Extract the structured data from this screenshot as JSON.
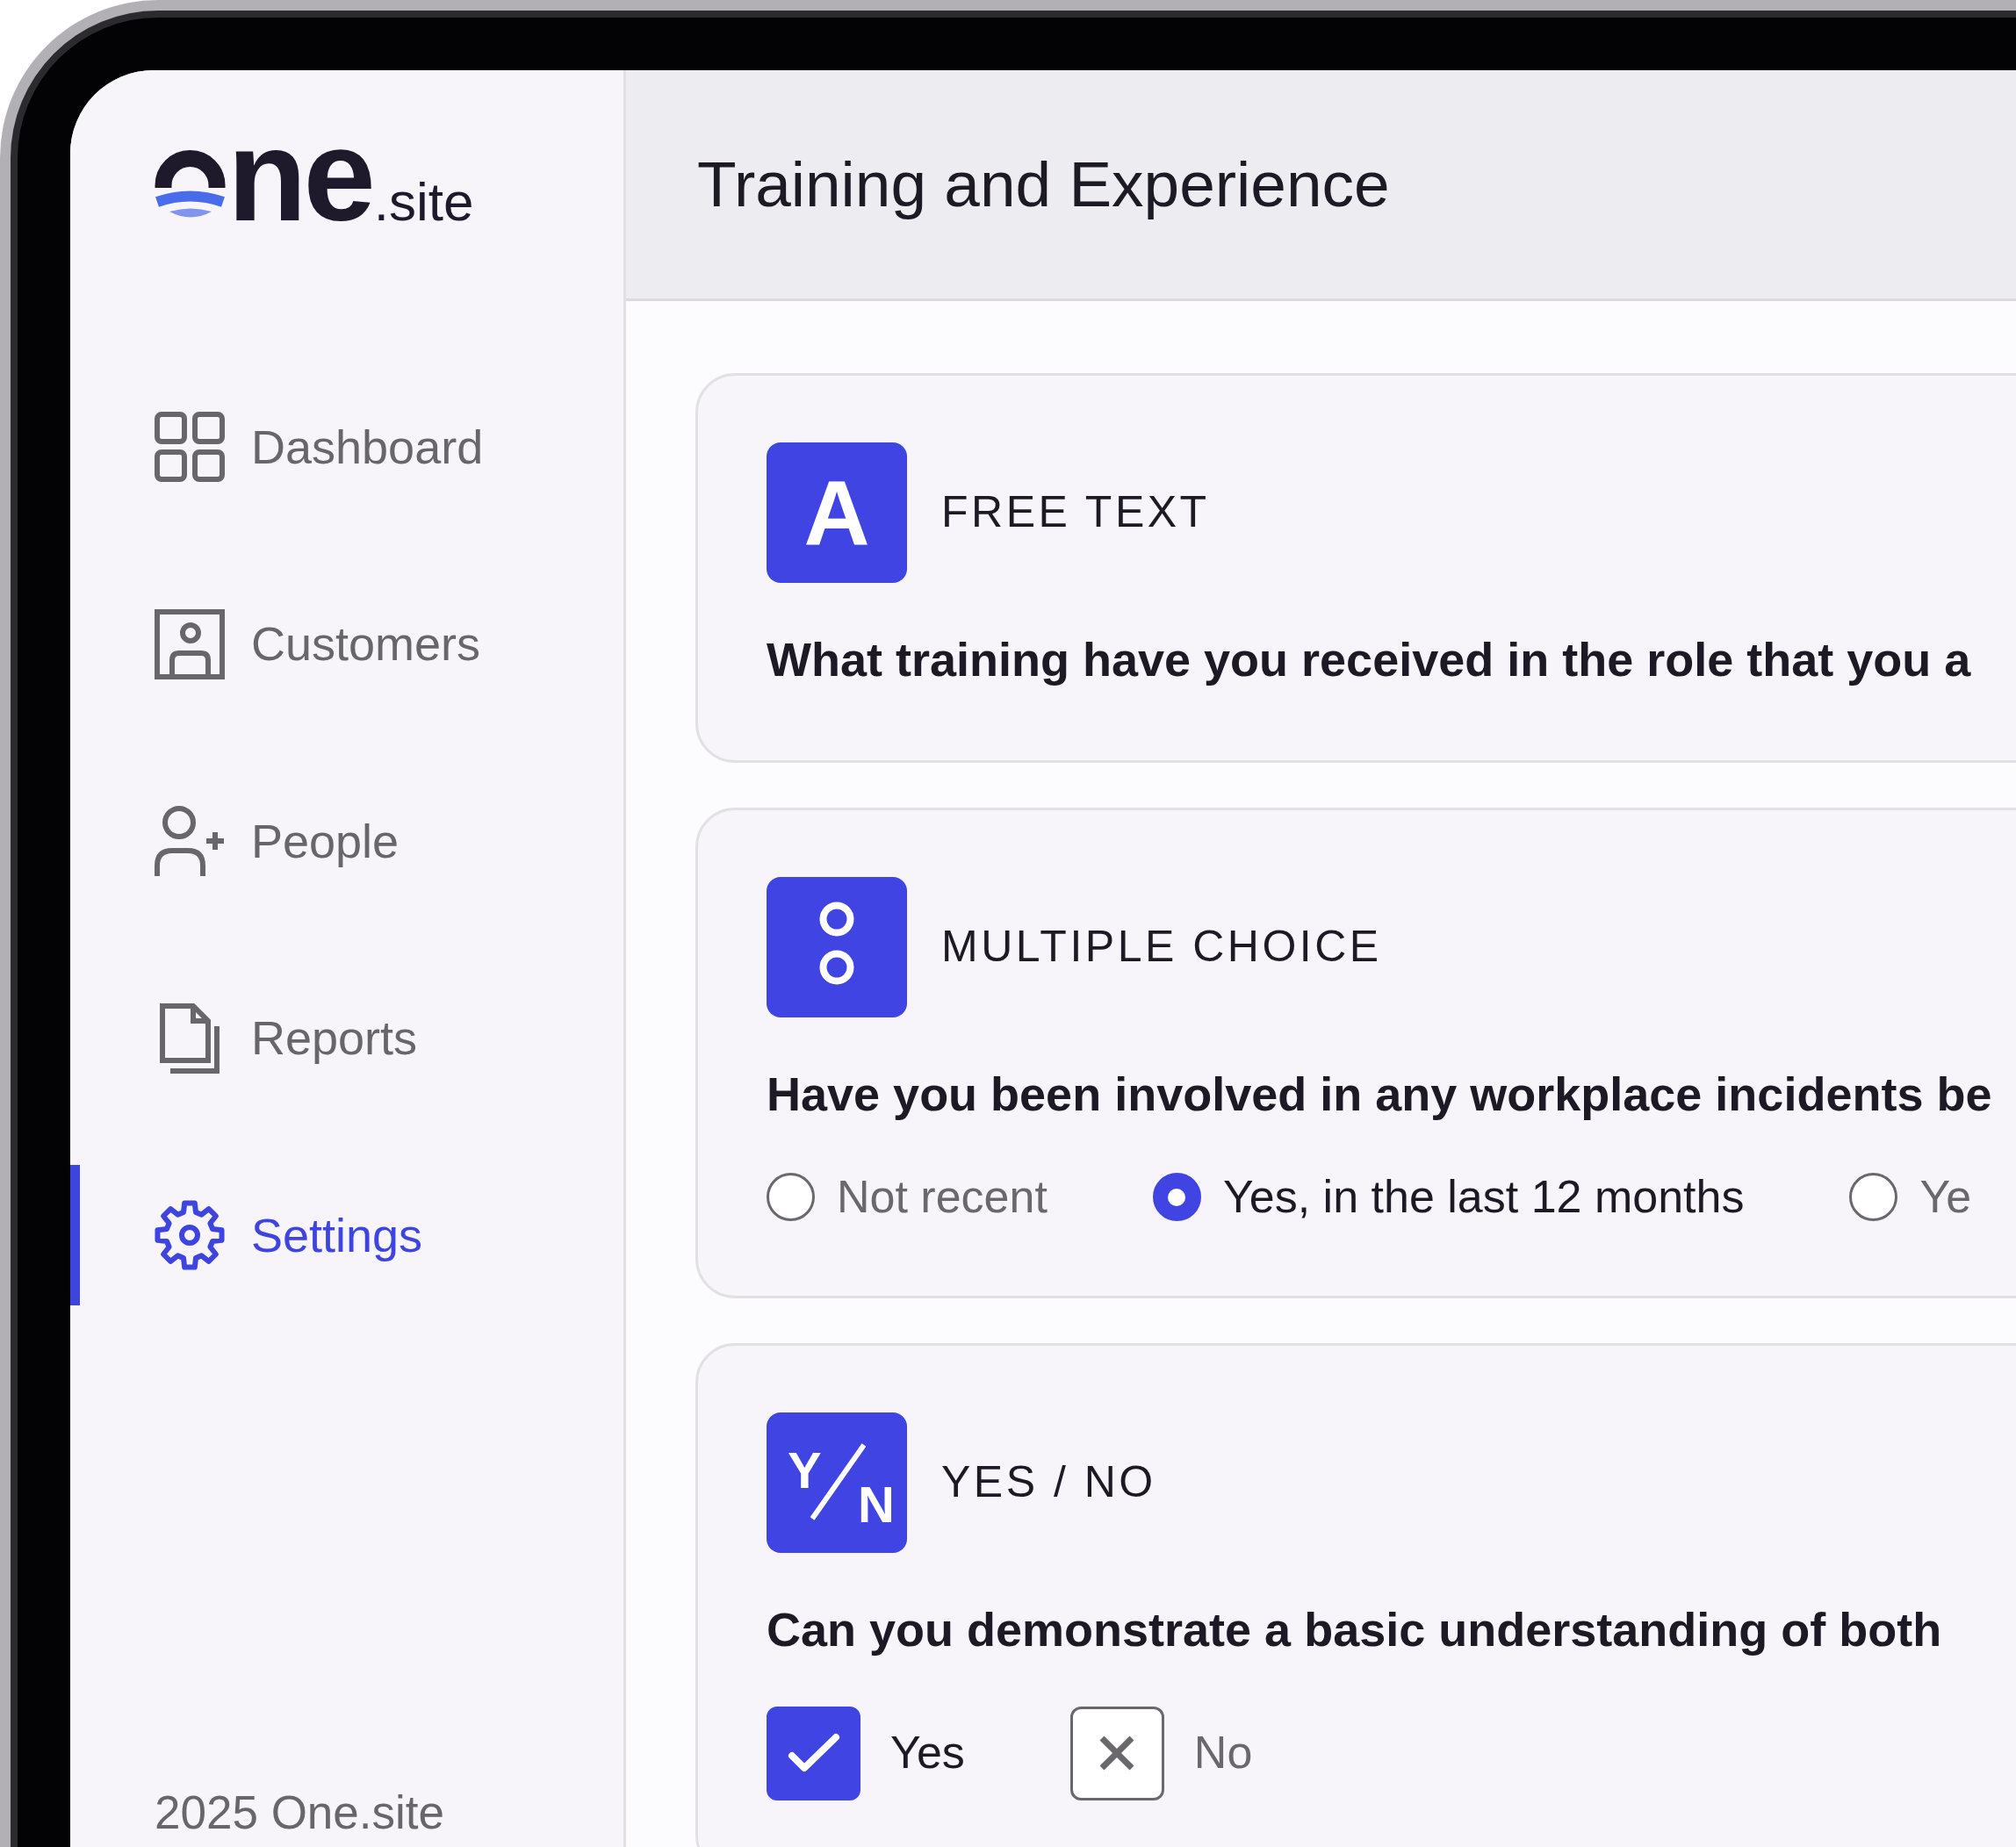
{
  "logo": {
    "wordmark": "ne",
    "suffix": ".site"
  },
  "nav": [
    {
      "kind": "dashboard",
      "label": "Dashboard",
      "selected": false
    },
    {
      "kind": "customers",
      "label": "Customers",
      "selected": false
    },
    {
      "kind": "people",
      "label": "People",
      "selected": false
    },
    {
      "kind": "reports",
      "label": "Reports",
      "selected": false
    },
    {
      "kind": "settings",
      "label": "Settings",
      "selected": true
    }
  ],
  "footer": "2025 One.site",
  "header": {
    "title": "Training and Experience"
  },
  "questions": [
    {
      "kind": "free_text",
      "badge": "A",
      "type_label": "FREE TEXT",
      "question": "What training have you received in the role that you a"
    },
    {
      "kind": "multiple_choice",
      "type_label": "MULTIPLE CHOICE",
      "question": "Have you been involved in any workplace incidents be",
      "options": [
        {
          "label": "Not recent",
          "selected": false
        },
        {
          "label": "Yes, in the last 12 months",
          "selected": true
        },
        {
          "label": "Ye",
          "selected": false
        }
      ]
    },
    {
      "kind": "yes_no",
      "badge": [
        "Y",
        "N"
      ],
      "type_label": "YES / NO",
      "question": "Can you demonstrate a basic understanding of both",
      "options": [
        {
          "kind": "yes",
          "label": "Yes",
          "selected": true
        },
        {
          "kind": "no",
          "label": "No",
          "selected": false
        }
      ]
    }
  ]
}
